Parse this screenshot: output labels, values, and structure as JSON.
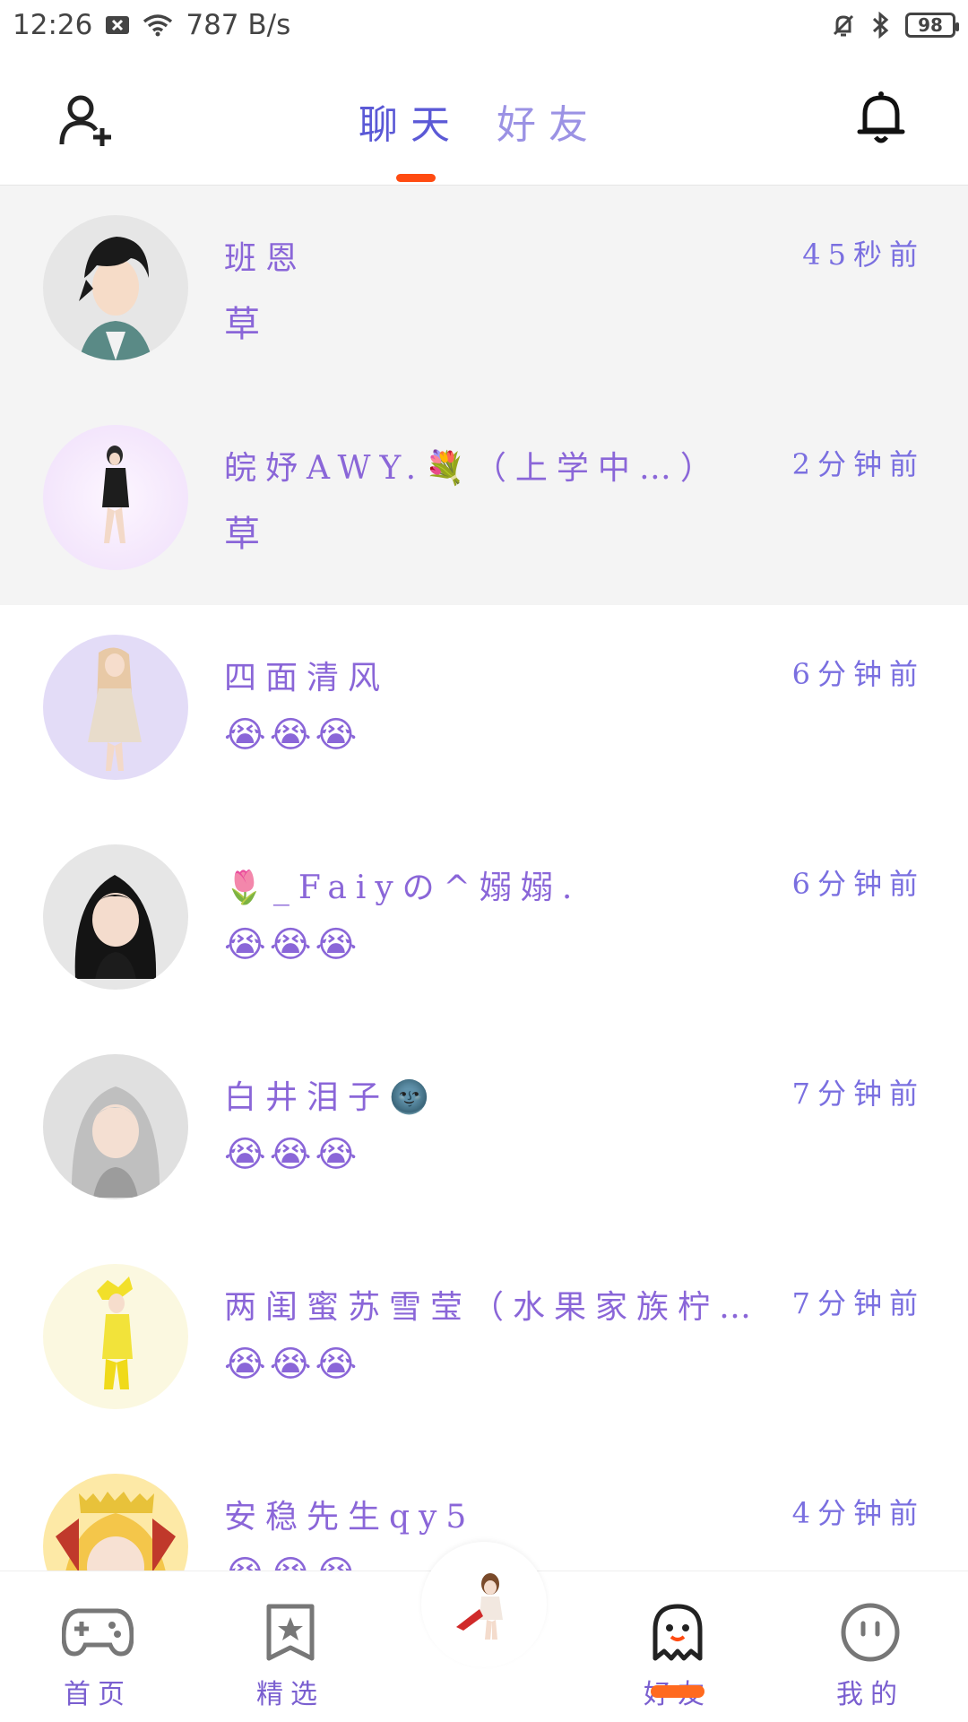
{
  "status_bar": {
    "time": "12:26",
    "network_speed": "787 B/s",
    "battery": "98",
    "icons": [
      "close-box-icon",
      "wifi-icon",
      "bell-muted-icon",
      "bluetooth-icon",
      "battery-icon"
    ]
  },
  "header": {
    "tabs": [
      {
        "label": "聊天",
        "active": true
      },
      {
        "label": "好友",
        "active": false
      }
    ],
    "left_icon": "add-user-icon",
    "right_icon": "bell-icon"
  },
  "colors": {
    "accent": "#ff4b12",
    "name_purple": "#8a66d8",
    "time_blue": "#7a6fe0",
    "pinned_bg": "#f4f4f4"
  },
  "chats": [
    {
      "name": "班恩",
      "time": "45秒前",
      "preview": "草",
      "pinned": true,
      "avatar_color": "#e6e6e6"
    },
    {
      "name": "皖妤AWY.💐（上学中…）",
      "time": "2分钟前",
      "preview": "草",
      "pinned": true,
      "avatar_color": "#f3e9fb"
    },
    {
      "name": "四面清风",
      "time": "6分钟前",
      "preview": "😭😭😭",
      "pinned": false,
      "avatar_color": "#e3dcf7"
    },
    {
      "name": "🌷_Faiyの^嫋嫋.",
      "time": "6分钟前",
      "preview": "😭😭😭",
      "pinned": false,
      "avatar_color": "#e6e6e6"
    },
    {
      "name": "白井泪子🌚",
      "time": "7分钟前",
      "preview": "😭😭😭",
      "pinned": false,
      "avatar_color": "#e0e0e0"
    },
    {
      "name": "两闺蜜苏雪莹（水果家族柠…",
      "time": "7分钟前",
      "preview": "😭😭😭",
      "pinned": false,
      "avatar_color": "#fbf8e0"
    },
    {
      "name": "安稳先生qy5",
      "time": "4分钟前",
      "preview": "😭😭😭",
      "pinned": false,
      "avatar_color": "#fde9a6"
    }
  ],
  "bottom_nav": [
    {
      "label": "首页",
      "icon": "gamepad-icon",
      "active": false
    },
    {
      "label": "精选",
      "icon": "star-bookmark-icon",
      "active": false
    },
    {
      "label": "好友",
      "icon": "ghost-icon",
      "active": true
    },
    {
      "label": "我的",
      "icon": "smiley-icon",
      "active": false
    }
  ]
}
